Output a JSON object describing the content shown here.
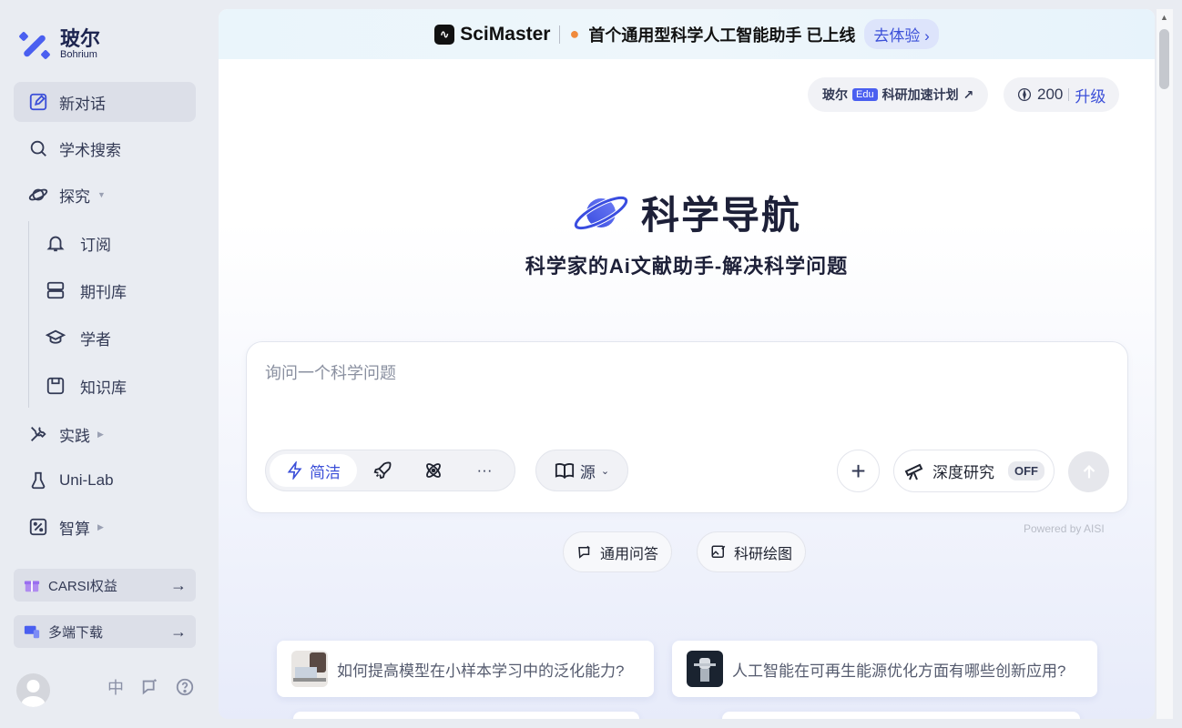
{
  "brand": {
    "name_cn": "玻尔",
    "name_en": "Bohrium"
  },
  "sidebar": {
    "items": [
      {
        "label": "新对话",
        "icon": "edit-icon",
        "active": true
      },
      {
        "label": "学术搜索",
        "icon": "search-icon"
      },
      {
        "label": "探究",
        "icon": "planet-icon",
        "expandable": true
      },
      {
        "label": "实践",
        "icon": "tools-icon",
        "expandable": true
      },
      {
        "label": "Uni-Lab",
        "icon": "flask-icon"
      },
      {
        "label": "智算",
        "icon": "percent-icon",
        "expandable": true
      }
    ],
    "subitems": [
      {
        "label": "订阅",
        "icon": "bell-icon"
      },
      {
        "label": "期刊库",
        "icon": "database-icon"
      },
      {
        "label": "学者",
        "icon": "graduation-cap-icon"
      },
      {
        "label": "知识库",
        "icon": "save-icon"
      }
    ],
    "promos": [
      {
        "label": "CARSI权益",
        "icon": "gift-icon"
      },
      {
        "label": "多端下载",
        "icon": "devices-icon"
      }
    ],
    "bottom": {
      "lang": "中",
      "feedback_icon": "chat-icon",
      "help_icon": "help-icon"
    }
  },
  "banner": {
    "product": "SciMaster",
    "text": "首个通用型科学人工智能助手 已上线",
    "cta": "去体验"
  },
  "header": {
    "edu_prefix": "玻尔",
    "edu_badge": "Edu",
    "edu_text": "科研加速计划",
    "edu_arrow": "↗",
    "credits": "200",
    "upgrade": "升级"
  },
  "hero": {
    "title": "科学导航",
    "subtitle": "科学家的Ai文献助手-解决科学问题"
  },
  "query": {
    "placeholder": "询问一个科学问题",
    "mode_selected": "简洁",
    "more": "···",
    "source_label": "源",
    "deep_research": "深度研究",
    "deep_state": "OFF",
    "powered_by": "Powered by AISI"
  },
  "chips": [
    {
      "label": "通用问答",
      "icon": "chat-refresh-icon"
    },
    {
      "label": "科研绘图",
      "icon": "image-edit-icon"
    }
  ],
  "suggestions": [
    {
      "text": "如何提高模型在小样本学习中的泛化能力?"
    },
    {
      "text": "人工智能在可再生能源优化方面有哪些创新应用?"
    }
  ],
  "colors": {
    "accent": "#3b4fd8",
    "sidebar_bg": "#e9ecf2",
    "hero_text": "#1d2038"
  }
}
